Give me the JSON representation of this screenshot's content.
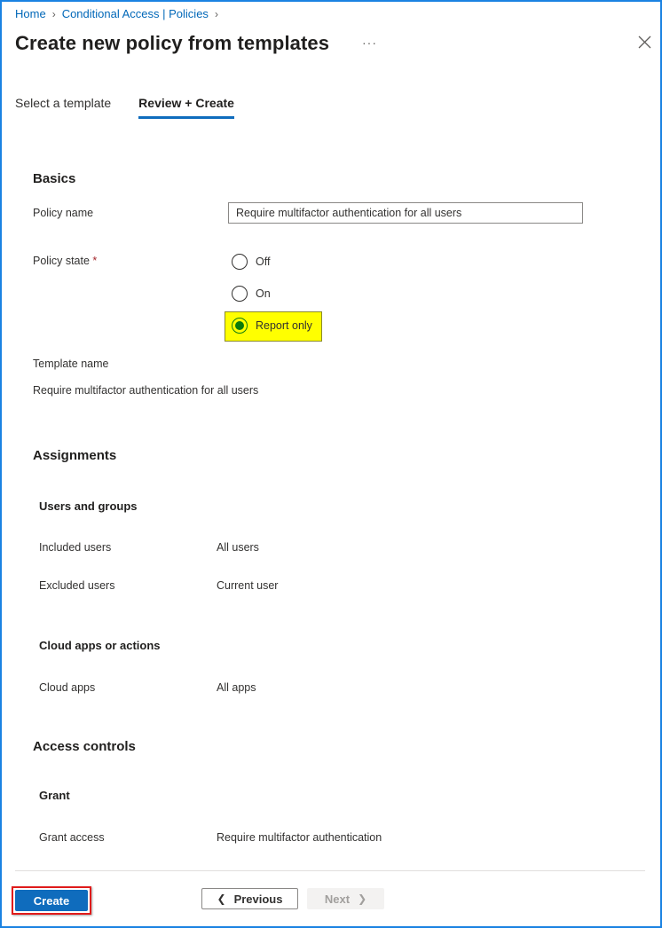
{
  "breadcrumb": [
    {
      "label": "Home"
    },
    {
      "label": "Conditional Access | Policies"
    }
  ],
  "header": {
    "title": "Create new policy from templates",
    "more_icon": "ellipsis-icon",
    "close_icon": "close-icon"
  },
  "tabs": [
    {
      "label": "Select a template",
      "active": false
    },
    {
      "label": "Review + Create",
      "active": true
    }
  ],
  "basics": {
    "heading": "Basics",
    "policy_name_label": "Policy name",
    "policy_name_value": "Require multifactor authentication for all users",
    "policy_state_label": "Policy state",
    "required_marker": "*",
    "policy_state_options": [
      {
        "label": "Off",
        "checked": false
      },
      {
        "label": "On",
        "checked": false
      },
      {
        "label": "Report only",
        "checked": true
      }
    ],
    "template_name_label": "Template name",
    "template_name_value": "Require multifactor authentication for all users"
  },
  "assignments": {
    "heading": "Assignments",
    "users_and_groups": {
      "heading": "Users and groups",
      "rows": [
        {
          "label": "Included users",
          "value": "All users"
        },
        {
          "label": "Excluded users",
          "value": "Current user"
        }
      ]
    },
    "cloud_apps": {
      "heading": "Cloud apps or actions",
      "rows": [
        {
          "label": "Cloud apps",
          "value": "All apps"
        }
      ]
    }
  },
  "access_controls": {
    "heading": "Access controls",
    "grant": {
      "heading": "Grant",
      "rows": [
        {
          "label": "Grant access",
          "value": "Require multifactor authentication"
        }
      ]
    }
  },
  "footer": {
    "create_label": "Create",
    "previous_label": "Previous",
    "next_label": "Next",
    "previous_icon": "chevron-left-icon",
    "next_icon": "chevron-right-icon"
  },
  "colors": {
    "accent": "#0f6cbd",
    "link": "#0067b8",
    "highlight": "#ffff00",
    "annotation_outline": "#e01b1b",
    "window_border": "#1a82e2"
  }
}
